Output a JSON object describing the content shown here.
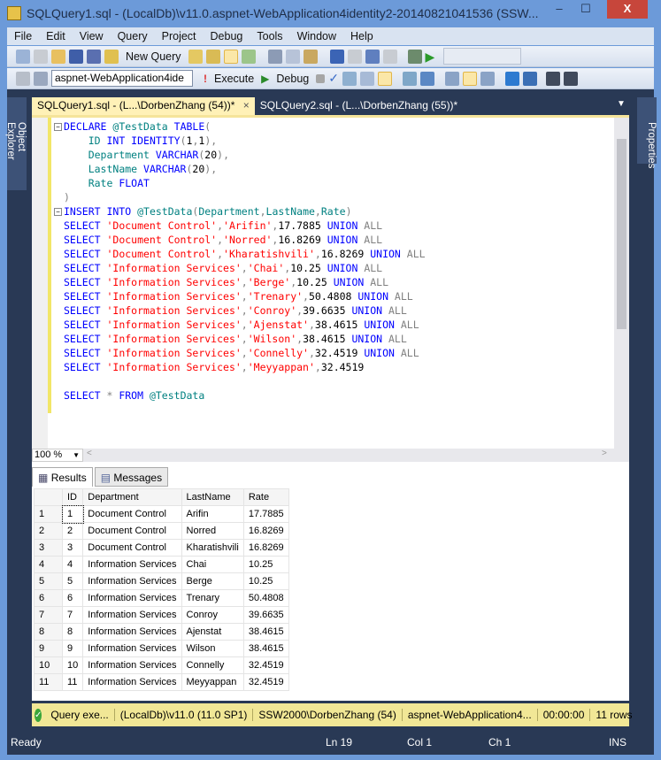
{
  "window": {
    "title": "SQLQuery1.sql - (LocalDb)\\v11.0.aspnet-WebApplication4identity2-20140821041536 (SSW...",
    "minimize": "–",
    "maximize": "☐",
    "close": "X"
  },
  "menu": [
    "File",
    "Edit",
    "View",
    "Query",
    "Project",
    "Debug",
    "Tools",
    "Window",
    "Help"
  ],
  "toolbar1": {
    "new_query": "New Query"
  },
  "toolbar2": {
    "database": "aspnet-WebApplication4ide",
    "execute": "Execute",
    "debug": "Debug"
  },
  "side": {
    "left": "Object Explorer",
    "right": "Properties"
  },
  "tabs": [
    {
      "label": "SQLQuery1.sql - (L...\\DorbenZhang (54))*",
      "close": "×"
    },
    {
      "label": "SQLQuery2.sql - (L...\\DorbenZhang (55))*"
    }
  ],
  "code": [
    [
      [
        "kw",
        "DECLARE "
      ],
      [
        "id",
        "@TestData "
      ],
      [
        "kw",
        "TABLE"
      ],
      [
        "gr",
        "("
      ]
    ],
    [
      [
        "pl",
        "    "
      ],
      [
        "id",
        "ID "
      ],
      [
        "kw",
        "INT IDENTITY"
      ],
      [
        "gr",
        "("
      ],
      [
        "pl",
        "1"
      ],
      [
        "gr",
        ","
      ],
      [
        "pl",
        "1"
      ],
      [
        "gr",
        "),"
      ]
    ],
    [
      [
        "pl",
        "    "
      ],
      [
        "id",
        "Department "
      ],
      [
        "kw",
        "VARCHAR"
      ],
      [
        "gr",
        "("
      ],
      [
        "pl",
        "20"
      ],
      [
        "gr",
        "),"
      ]
    ],
    [
      [
        "pl",
        "    "
      ],
      [
        "id",
        "LastName "
      ],
      [
        "kw",
        "VARCHAR"
      ],
      [
        "gr",
        "("
      ],
      [
        "pl",
        "20"
      ],
      [
        "gr",
        "),"
      ]
    ],
    [
      [
        "pl",
        "    "
      ],
      [
        "id",
        "Rate "
      ],
      [
        "kw",
        "FLOAT"
      ]
    ],
    [
      [
        "gr",
        ")"
      ]
    ],
    [
      [
        "kw",
        "INSERT INTO "
      ],
      [
        "id",
        "@TestData"
      ],
      [
        "gr",
        "("
      ],
      [
        "id",
        "Department"
      ],
      [
        "gr",
        ","
      ],
      [
        "id",
        "LastName"
      ],
      [
        "gr",
        ","
      ],
      [
        "id",
        "Rate"
      ],
      [
        "gr",
        ")"
      ]
    ],
    [
      [
        "kw",
        "SELECT "
      ],
      [
        "str",
        "'Document Control'"
      ],
      [
        "gr",
        ","
      ],
      [
        "str",
        "'Arifin'"
      ],
      [
        "gr",
        ","
      ],
      [
        "pl",
        "17.7885 "
      ],
      [
        "kw",
        "UNION "
      ],
      [
        "gr",
        "ALL"
      ]
    ],
    [
      [
        "kw",
        "SELECT "
      ],
      [
        "str",
        "'Document Control'"
      ],
      [
        "gr",
        ","
      ],
      [
        "str",
        "'Norred'"
      ],
      [
        "gr",
        ","
      ],
      [
        "pl",
        "16.8269 "
      ],
      [
        "kw",
        "UNION "
      ],
      [
        "gr",
        "ALL"
      ]
    ],
    [
      [
        "kw",
        "SELECT "
      ],
      [
        "str",
        "'Document Control'"
      ],
      [
        "gr",
        ","
      ],
      [
        "str",
        "'Kharatishvili'"
      ],
      [
        "gr",
        ","
      ],
      [
        "pl",
        "16.8269 "
      ],
      [
        "kw",
        "UNION "
      ],
      [
        "gr",
        "ALL"
      ]
    ],
    [
      [
        "kw",
        "SELECT "
      ],
      [
        "str",
        "'Information Services'"
      ],
      [
        "gr",
        ","
      ],
      [
        "str",
        "'Chai'"
      ],
      [
        "gr",
        ","
      ],
      [
        "pl",
        "10.25 "
      ],
      [
        "kw",
        "UNION "
      ],
      [
        "gr",
        "ALL"
      ]
    ],
    [
      [
        "kw",
        "SELECT "
      ],
      [
        "str",
        "'Information Services'"
      ],
      [
        "gr",
        ","
      ],
      [
        "str",
        "'Berge'"
      ],
      [
        "gr",
        ","
      ],
      [
        "pl",
        "10.25 "
      ],
      [
        "kw",
        "UNION "
      ],
      [
        "gr",
        "ALL"
      ]
    ],
    [
      [
        "kw",
        "SELECT "
      ],
      [
        "str",
        "'Information Services'"
      ],
      [
        "gr",
        ","
      ],
      [
        "str",
        "'Trenary'"
      ],
      [
        "gr",
        ","
      ],
      [
        "pl",
        "50.4808 "
      ],
      [
        "kw",
        "UNION "
      ],
      [
        "gr",
        "ALL"
      ]
    ],
    [
      [
        "kw",
        "SELECT "
      ],
      [
        "str",
        "'Information Services'"
      ],
      [
        "gr",
        ","
      ],
      [
        "str",
        "'Conroy'"
      ],
      [
        "gr",
        ","
      ],
      [
        "pl",
        "39.6635 "
      ],
      [
        "kw",
        "UNION "
      ],
      [
        "gr",
        "ALL"
      ]
    ],
    [
      [
        "kw",
        "SELECT "
      ],
      [
        "str",
        "'Information Services'"
      ],
      [
        "gr",
        ","
      ],
      [
        "str",
        "'Ajenstat'"
      ],
      [
        "gr",
        ","
      ],
      [
        "pl",
        "38.4615 "
      ],
      [
        "kw",
        "UNION "
      ],
      [
        "gr",
        "ALL"
      ]
    ],
    [
      [
        "kw",
        "SELECT "
      ],
      [
        "str",
        "'Information Services'"
      ],
      [
        "gr",
        ","
      ],
      [
        "str",
        "'Wilson'"
      ],
      [
        "gr",
        ","
      ],
      [
        "pl",
        "38.4615 "
      ],
      [
        "kw",
        "UNION "
      ],
      [
        "gr",
        "ALL"
      ]
    ],
    [
      [
        "kw",
        "SELECT "
      ],
      [
        "str",
        "'Information Services'"
      ],
      [
        "gr",
        ","
      ],
      [
        "str",
        "'Connelly'"
      ],
      [
        "gr",
        ","
      ],
      [
        "pl",
        "32.4519 "
      ],
      [
        "kw",
        "UNION "
      ],
      [
        "gr",
        "ALL"
      ]
    ],
    [
      [
        "kw",
        "SELECT "
      ],
      [
        "str",
        "'Information Services'"
      ],
      [
        "gr",
        ","
      ],
      [
        "str",
        "'Meyyappan'"
      ],
      [
        "gr",
        ","
      ],
      [
        "pl",
        "32.4519"
      ]
    ],
    [],
    [
      [
        "kw",
        "SELECT "
      ],
      [
        "gr",
        "* "
      ],
      [
        "kw",
        "FROM "
      ],
      [
        "id",
        "@TestData"
      ]
    ]
  ],
  "zoom": "100 %",
  "results": {
    "tabs": [
      "Results",
      "Messages"
    ],
    "columns": [
      "",
      "ID",
      "Department",
      "LastName",
      "Rate"
    ],
    "rows": [
      [
        "1",
        "1",
        "Document Control",
        "Arifin",
        "17.7885"
      ],
      [
        "2",
        "2",
        "Document Control",
        "Norred",
        "16.8269"
      ],
      [
        "3",
        "3",
        "Document Control",
        "Kharatishvili",
        "16.8269"
      ],
      [
        "4",
        "4",
        "Information Services",
        "Chai",
        "10.25"
      ],
      [
        "5",
        "5",
        "Information Services",
        "Berge",
        "10.25"
      ],
      [
        "6",
        "6",
        "Information Services",
        "Trenary",
        "50.4808"
      ],
      [
        "7",
        "7",
        "Information Services",
        "Conroy",
        "39.6635"
      ],
      [
        "8",
        "8",
        "Information Services",
        "Ajenstat",
        "38.4615"
      ],
      [
        "9",
        "9",
        "Information Services",
        "Wilson",
        "38.4615"
      ],
      [
        "10",
        "10",
        "Information Services",
        "Connelly",
        "32.4519"
      ],
      [
        "11",
        "11",
        "Information Services",
        "Meyyappan",
        "32.4519"
      ]
    ]
  },
  "query_status": {
    "message": "Query exe...",
    "server": "(LocalDb)\\v11.0 (11.0 SP1)",
    "user": "SSW2000\\DorbenZhang (54)",
    "database": "aspnet-WebApplication4...",
    "time": "00:00:00",
    "rows": "11 rows"
  },
  "status": {
    "ready": "Ready",
    "ln": "Ln 19",
    "col": "Col 1",
    "ch": "Ch 1",
    "ins": "INS"
  }
}
